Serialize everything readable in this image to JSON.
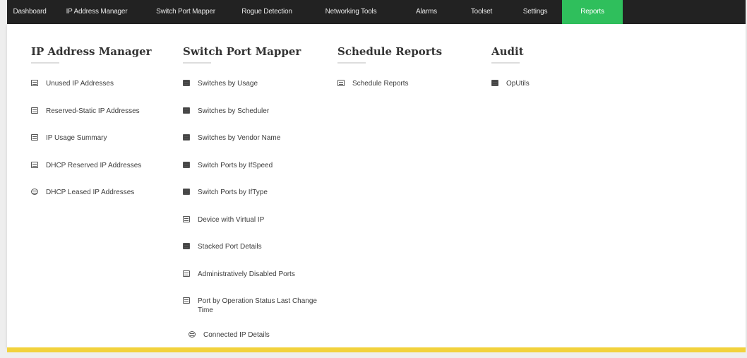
{
  "nav": {
    "items": [
      {
        "label": "Dashboard"
      },
      {
        "label": "IP Address Manager"
      },
      {
        "label": "Switch Port Mapper"
      },
      {
        "label": "Rogue Detection"
      },
      {
        "label": "Networking Tools"
      },
      {
        "label": "Alarms"
      },
      {
        "label": "Toolset"
      },
      {
        "label": "Settings"
      },
      {
        "label": "Reports",
        "active": true
      }
    ]
  },
  "columns": [
    {
      "title": "IP Address Manager",
      "items": [
        {
          "label": "Unused IP Addresses",
          "icon": "table-icon"
        },
        {
          "label": "Reserved-Static IP Addresses",
          "icon": "table-icon"
        },
        {
          "label": "IP Usage Summary",
          "icon": "table-icon"
        },
        {
          "label": "DHCP Reserved IP Addresses",
          "icon": "dhcp-icon"
        },
        {
          "label": "DHCP Leased IP Addresses",
          "icon": "globe-icon"
        }
      ]
    },
    {
      "title": "Switch Port Mapper",
      "items": [
        {
          "label": "Switches by Usage",
          "icon": "switch-icon"
        },
        {
          "label": "Switches by Scheduler",
          "icon": "switch-icon"
        },
        {
          "label": "Switches by Vendor Name",
          "icon": "switch-icon"
        },
        {
          "label": "Switch Ports by IfSpeed",
          "icon": "switch-icon"
        },
        {
          "label": "Switch Ports by IfType",
          "icon": "switch-icon"
        },
        {
          "label": "Device with Virtual IP",
          "icon": "device-icon"
        },
        {
          "label": "Stacked Port Details",
          "icon": "stack-icon"
        },
        {
          "label": "Administratively Disabled Ports",
          "icon": "user-icon"
        },
        {
          "label": "Port by Operation Status Last Change Time",
          "icon": "clock-icon"
        },
        {
          "label": "Connected IP Details",
          "icon": "connection-icon"
        }
      ]
    },
    {
      "title": "Schedule Reports",
      "items": [
        {
          "label": "Schedule Reports",
          "icon": "schedule-icon"
        }
      ]
    },
    {
      "title": "Audit",
      "items": [
        {
          "label": "OpUtils",
          "icon": "audit-icon"
        }
      ]
    }
  ]
}
